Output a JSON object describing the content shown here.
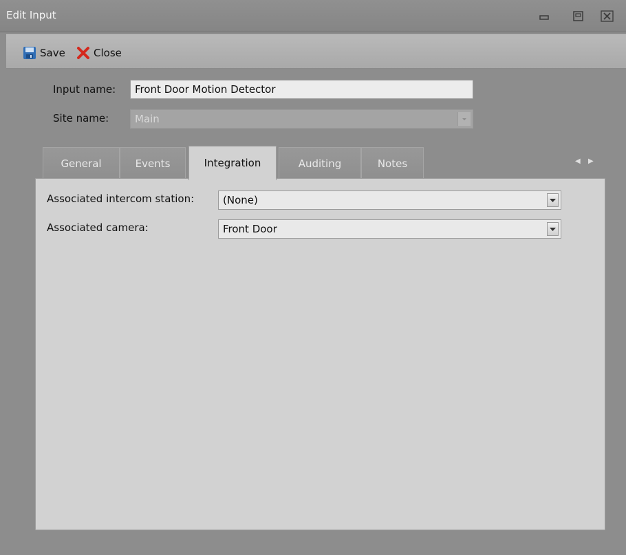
{
  "window": {
    "title": "Edit Input"
  },
  "toolbar": {
    "save_label": "Save",
    "close_label": "Close"
  },
  "form": {
    "input_name_label": "Input name:",
    "input_name_value": "Front Door Motion Detector",
    "site_name_label": "Site name:",
    "site_name_value": "Main"
  },
  "tabs": [
    {
      "label": "General",
      "active": false
    },
    {
      "label": "Events",
      "active": false
    },
    {
      "label": "Integration",
      "active": true
    },
    {
      "label": "Auditing",
      "active": false
    },
    {
      "label": "Notes",
      "active": false
    }
  ],
  "integration": {
    "intercom_label": "Associated intercom station:",
    "intercom_value": "(None)",
    "camera_label": "Associated camera:",
    "camera_value": "Front Door"
  },
  "icons": {
    "save": "floppy-disk-icon",
    "close": "red-x-icon",
    "minimize": "minimize-icon",
    "maximize": "maximize-icon",
    "window_close": "window-close-icon",
    "tab_left": "scroll-left-icon",
    "tab_right": "scroll-right-icon",
    "dropdown": "chevron-down-icon"
  },
  "colors": {
    "accent_close": "#d4281c",
    "save_blue": "#2f6db5"
  }
}
